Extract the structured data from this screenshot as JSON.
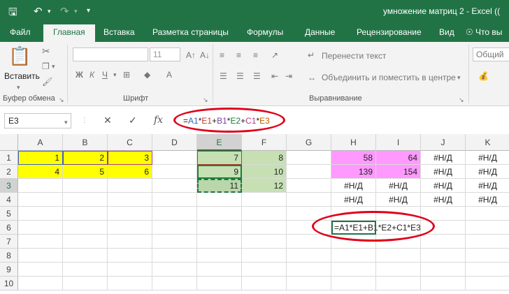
{
  "titlebar": {
    "title": "умножение матриц 2 - Excel (("
  },
  "tabs": [
    "Файл",
    "Главная",
    "Вставка",
    "Разметка страницы",
    "Формулы",
    "Данные",
    "Рецензирование",
    "Вид"
  ],
  "tell_me": "Что вы",
  "ribbon": {
    "paste_label": "Вставить",
    "clipboard_label": "Буфер обмена",
    "font_label": "Шрифт",
    "font_size": "11",
    "align_label": "Выравнивание",
    "wrap_text": "Перенести текст",
    "merge_center": "Объединить и поместить в центре",
    "number_format": "Общий",
    "bold": "Ж",
    "italic": "К",
    "underline": "Ч"
  },
  "formula_bar": {
    "name_box": "E3",
    "fx": "fx",
    "formula_parts": [
      "=",
      "A1",
      "*",
      "E1",
      "+",
      "B1",
      "*",
      "E2",
      "+",
      "C1",
      "*",
      "E3"
    ]
  },
  "columns": [
    "A",
    "B",
    "C",
    "D",
    "E",
    "F",
    "G",
    "H",
    "I",
    "J",
    "K"
  ],
  "rows": [
    "1",
    "2",
    "3",
    "4",
    "5",
    "6",
    "7",
    "8",
    "9",
    "10"
  ],
  "cells": {
    "A1": "1",
    "B1": "2",
    "C1": "3",
    "A2": "4",
    "B2": "5",
    "C2": "6",
    "E1": "7",
    "F1": "8",
    "E2": "9",
    "F2": "10",
    "E3": "11",
    "F3": "12",
    "H1": "58",
    "I1": "64",
    "J1": "#Н/Д",
    "K1": "#Н/Д",
    "H2": "139",
    "I2": "154",
    "J2": "#Н/Д",
    "K2": "#Н/Д",
    "H3": "#Н/Д",
    "I3": "#Н/Д",
    "J3": "#Н/Д",
    "K3": "#Н/Д",
    "H4": "#Н/Д",
    "I4": "#Н/Д",
    "J4": "#Н/Д",
    "K4": "#Н/Д",
    "H6": "=A1*E1+B1*E2+C1*E3"
  },
  "colors": {
    "excel_green": "#217346",
    "yellow": "#ffff00",
    "green_fill": "#c6e0b4",
    "pink": "#ff99ff",
    "annotation_red": "#e0001a"
  }
}
